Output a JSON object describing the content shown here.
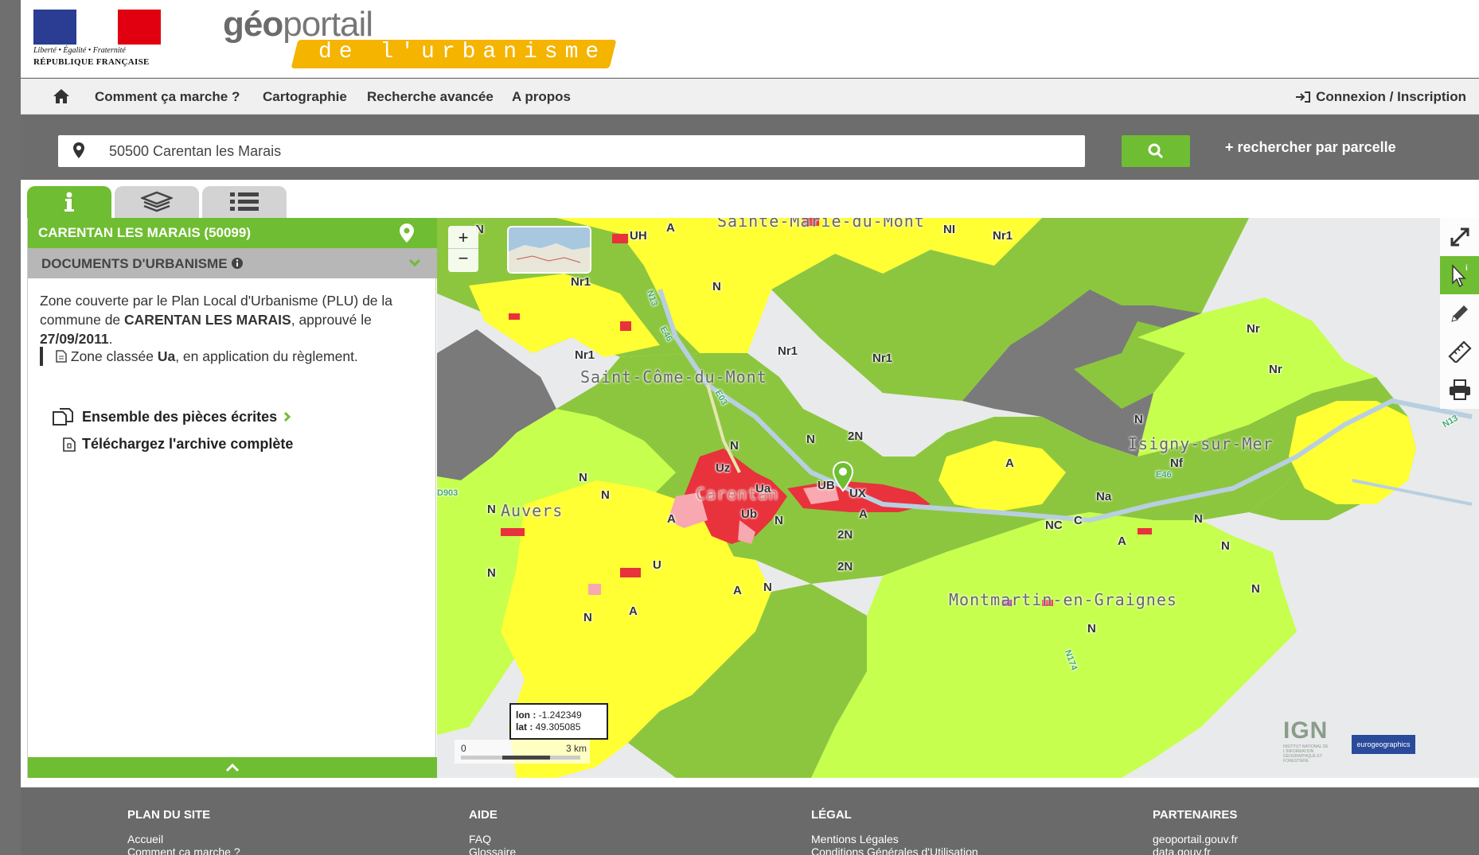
{
  "header": {
    "rf_motto": "Liberté • Égalité • Fraternité",
    "rf_name": "RÉPUBLIQUE FRANÇAISE",
    "logo_geo": "géo",
    "logo_portail": "portail",
    "logo_sub": "de l'urbanisme"
  },
  "nav": {
    "items": [
      "Comment ça marche ?",
      "Cartographie",
      "Recherche avancée",
      "A propos"
    ],
    "login": "Connexion / Inscription"
  },
  "search": {
    "value": "50500 Carentan les Marais",
    "parcel_link": "+ rechercher par parcelle"
  },
  "panel": {
    "commune": "CARENTAN LES MARAIS (50099)",
    "docs_title": "DOCUMENTS D'URBANISME",
    "desc_1": "Zone couverte par le Plan Local d'Urbanisme (PLU) de la commune de ",
    "desc_commune": "CARENTAN LES MARAIS",
    "desc_2": ", approuvé le ",
    "desc_date": "27/09/2011",
    "desc_3": ".",
    "zone_1": "Zone classée ",
    "zone_code": "Ua",
    "zone_2": ", en application du règlement.",
    "pieces_link": "Ensemble des pièces écrites",
    "archive_link": "Téléchargez l'archive complète"
  },
  "map": {
    "zoom_in": "+",
    "zoom_out": "−",
    "coords": {
      "lon_label": "lon : ",
      "lon": "-1.242349",
      "lat_label": "lat : ",
      "lat": "49.305085"
    },
    "scale": {
      "start": "0",
      "end": "3 km"
    },
    "places": [
      "Sainte-Marie-du-Mont",
      "Saint-Côme-du-Mont",
      "Isigny-sur-Mer",
      "Auvers",
      "Montmartin-en-Graignes",
      "Carentan"
    ],
    "roads": [
      "N13",
      "E46",
      "E03",
      "N13",
      "E46",
      "D903",
      "N174"
    ],
    "zones": [
      "N",
      "UH",
      "A",
      "NI",
      "Nr1",
      "Nr1",
      "N",
      "Nr1",
      "Nr1",
      "Nr1",
      "Nr",
      "Nr",
      "N",
      "2N",
      "N",
      "N",
      "A",
      "Nf",
      "Uz",
      "Ua",
      "UB",
      "UX",
      "A",
      "N",
      "Ub",
      "N",
      "2N",
      "2N",
      "N",
      "NC",
      "C",
      "Na",
      "A",
      "N",
      "N",
      "A",
      "U",
      "A",
      "N",
      "A",
      "N",
      "N",
      "N",
      "N",
      "N"
    ],
    "ign": "IGN",
    "ign_sub": "INSTITUT NATIONAL DE L'INFORMATION GÉOGRAPHIQUE ET FORESTIÈRE",
    "eurogeo": "eurogeographics"
  },
  "footer": {
    "plan_title": "PLAN DU SITE",
    "plan_links": [
      "Accueil",
      "Comment ça marche ?"
    ],
    "aide_title": "AIDE",
    "aide_links": [
      "FAQ",
      "Glossaire"
    ],
    "legal_title": "LÉGAL",
    "legal_links": [
      "Mentions Légales",
      "Conditions Générales d'Utilisation"
    ],
    "partners_title": "PARTENAIRES",
    "partners_links": [
      "geoportail.gouv.fr",
      "data.gouv.fr"
    ]
  },
  "colors": {
    "accent": "#6fbd32",
    "zone_N": "#8cc63f",
    "zone_A": "#ffff33",
    "zone_U": "#e8323c",
    "zone_2N": "#c6ff4d"
  }
}
